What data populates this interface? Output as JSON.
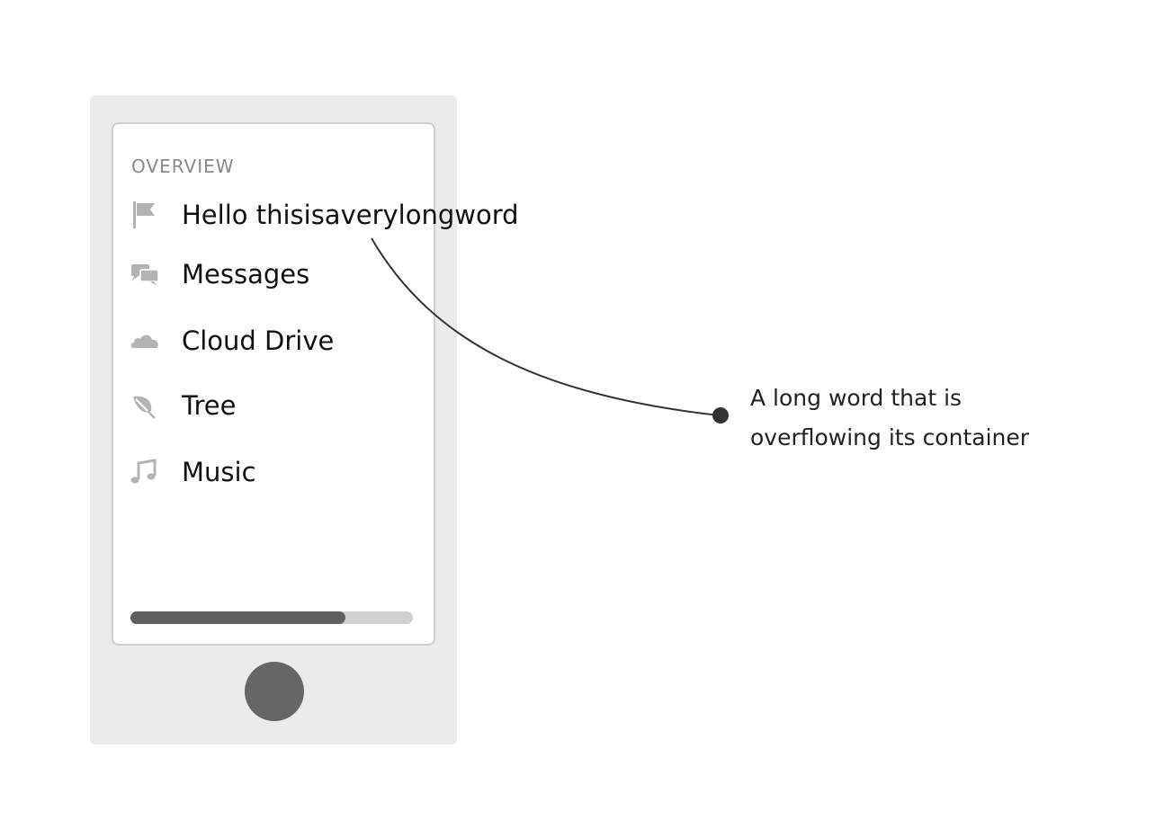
{
  "device": {
    "section_label": "OVERVIEW",
    "menu": [
      {
        "label": "Hello thisisaverylongword",
        "icon": "flag-icon"
      },
      {
        "label": "Messages",
        "icon": "chat-bubbles-icon"
      },
      {
        "label": "Cloud Drive",
        "icon": "cloud-icon"
      },
      {
        "label": "Tree",
        "icon": "leaf-icon"
      },
      {
        "label": "Music",
        "icon": "music-note-icon"
      }
    ],
    "progress": 0.76
  },
  "annotation": {
    "line1": "A long word that is",
    "line2": "overflowing its container"
  },
  "colors": {
    "device_frame": "#ebebeb",
    "icon": "#b3b3b3",
    "progress_fill": "#5f5f5f",
    "progress_track": "#d0d0d0",
    "home_button": "#666666",
    "connector": "#333333"
  }
}
